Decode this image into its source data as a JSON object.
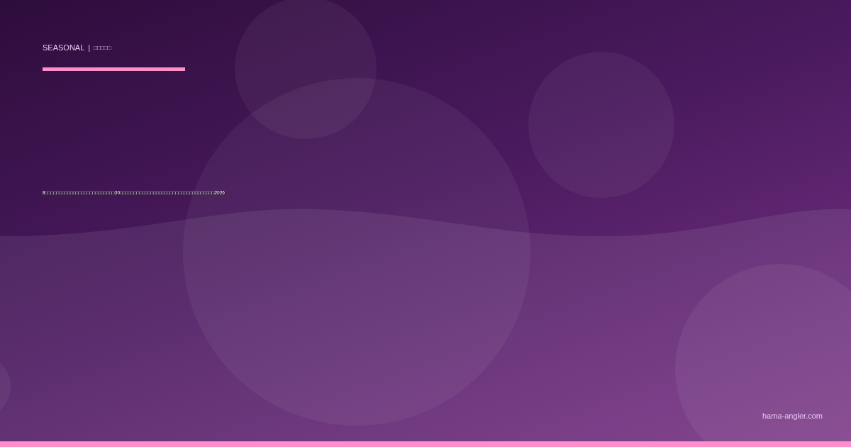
{
  "category": {
    "label": "SEASONAL",
    "separator": "|",
    "name": "□□□□□"
  },
  "title": "8□□□□□□□□□□□□□□□□□□□□□□□□□30□□□□□□□□□□□□□□□□□□□□□□□□□□□□□□□□□□2026",
  "site": "hama-angler.com"
}
